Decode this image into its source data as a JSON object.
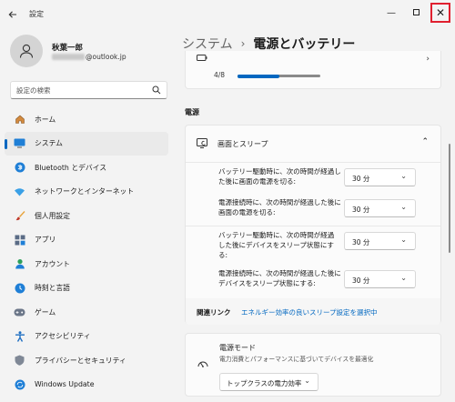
{
  "window": {
    "title": "設定",
    "minimize_glyph": "—",
    "close_glyph": "✕"
  },
  "user": {
    "name": "秋葉一郎",
    "email_suffix": "@outlook.jp"
  },
  "search": {
    "placeholder": "設定の検索"
  },
  "nav": [
    {
      "label": "ホーム",
      "icon": "home-icon"
    },
    {
      "label": "システム",
      "icon": "system-icon",
      "active": true
    },
    {
      "label": "Bluetooth とデバイス",
      "icon": "bluetooth-icon"
    },
    {
      "label": "ネットワークとインターネット",
      "icon": "network-icon"
    },
    {
      "label": "個人用設定",
      "icon": "brush-icon"
    },
    {
      "label": "アプリ",
      "icon": "apps-icon"
    },
    {
      "label": "アカウント",
      "icon": "account-icon"
    },
    {
      "label": "時刻と言語",
      "icon": "time-language-icon"
    },
    {
      "label": "ゲーム",
      "icon": "gaming-icon"
    },
    {
      "label": "アクセシビリティ",
      "icon": "accessibility-icon"
    },
    {
      "label": "プライバシーとセキュリティ",
      "icon": "shield-icon"
    },
    {
      "label": "Windows Update",
      "icon": "update-icon"
    }
  ],
  "header": {
    "root": "システム",
    "separator": "›",
    "current": "電源とバッテリー"
  },
  "battery": {
    "count": "4/8",
    "progress": 0.5,
    "chevron": "›"
  },
  "power": {
    "section_title": "電源",
    "sleep_label": "画面とスリープ",
    "chevron_up": "⌃",
    "settings": [
      {
        "text": "バッテリー駆動時に、次の時間が経過した後に画面の電源を切る:",
        "value": "30 分"
      },
      {
        "text": "電源接続時に、次の時間が経過した後に画面の電源を切る:",
        "value": "30 分"
      },
      {
        "text": "バッテリー駆動時に、次の時間が経過した後にデバイスをスリープ状態にする:",
        "value": "30 分"
      },
      {
        "text": "電源接続時に、次の時間が経過した後にデバイスをスリープ状態にする:",
        "value": "30 分"
      }
    ],
    "dropdown_chevron": "⌄",
    "related_label": "関連リンク",
    "related_link": "エネルギー効率の良いスリープ設定を選択中"
  },
  "power_mode": {
    "title": "電源モード",
    "description": "電力消費とパフォーマンスに基づいてデバイスを最適化",
    "value": "トップクラスの電力効率"
  },
  "colors": {
    "accent": "#0067c0",
    "close_highlight": "#e0202f"
  }
}
